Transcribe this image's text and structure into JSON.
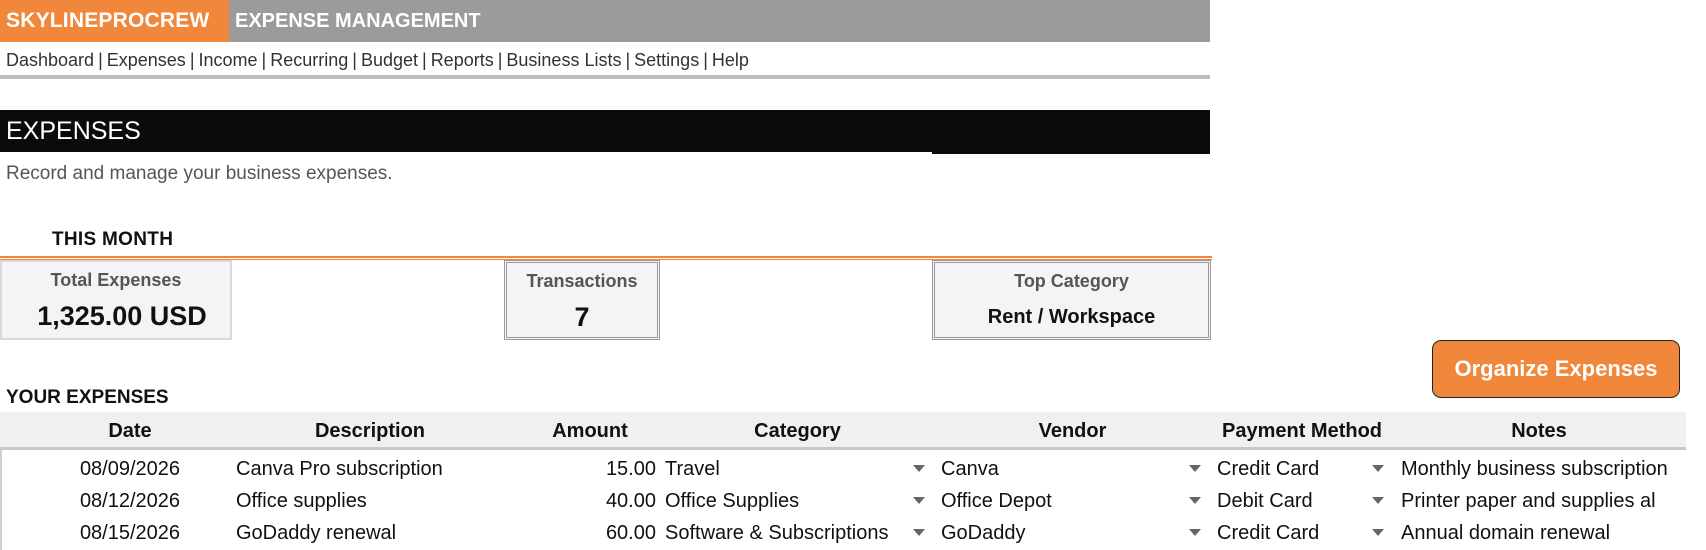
{
  "header": {
    "brand": "SKYLINEPROCREW",
    "title": "EXPENSE MANAGEMENT"
  },
  "nav": [
    "Dashboard",
    "Expenses",
    "Income",
    "Recurring",
    "Budget",
    "Reports",
    "Business Lists",
    "Settings",
    "Help"
  ],
  "section": {
    "title": "EXPENSES",
    "subtitle": "Record and manage your business expenses."
  },
  "summary": {
    "heading": "THIS MONTH",
    "total_label": "Total Expenses",
    "total_value": "1,325.00 USD",
    "transactions_label": "Transactions",
    "transactions_value": "7",
    "top_label": "Top Category",
    "top_value": "Rent / Workspace"
  },
  "actions": {
    "organize_label": "Organize Expenses"
  },
  "table": {
    "heading": "YOUR EXPENSES",
    "columns": [
      "Date",
      "Description",
      "Amount",
      "Category",
      "Vendor",
      "Payment Method",
      "Notes"
    ],
    "rows": [
      {
        "date": "08/09/2026",
        "description": "Canva Pro subscription",
        "amount": "15.00",
        "category": "Travel",
        "vendor": "Canva",
        "payment": "Credit Card",
        "notes": "Monthly business subscription"
      },
      {
        "date": "08/12/2026",
        "description": "Office supplies",
        "amount": "40.00",
        "category": "Office Supplies",
        "vendor": "Office Depot",
        "payment": "Debit Card",
        "notes": "Printer paper and supplies al"
      },
      {
        "date": "08/15/2026",
        "description": "GoDaddy renewal",
        "amount": "60.00",
        "category": "Software & Subscriptions",
        "vendor": "GoDaddy",
        "payment": "Credit Card",
        "notes": "Annual domain renewal"
      }
    ]
  },
  "colors": {
    "accent": "#f0873a",
    "header_gray": "#9b9b9b",
    "section_black": "#0b0b0b"
  }
}
